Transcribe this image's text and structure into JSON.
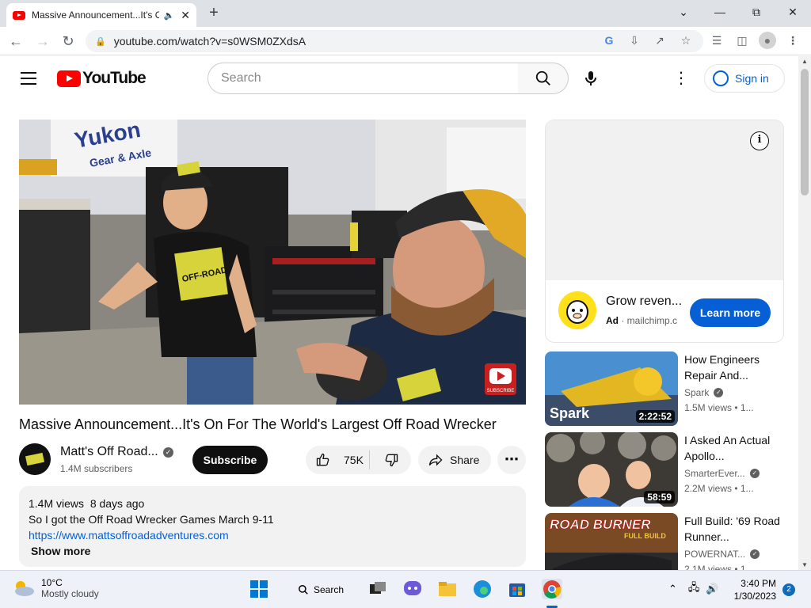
{
  "browser": {
    "tab_title": "Massive Announcement...It's On For The World's Largest Off Road Wrecker",
    "url": "youtube.com/watch?v=s0WSM0ZXdsA"
  },
  "youtube": {
    "logo_text": "YouTube",
    "search_placeholder": "Search",
    "signin_label": "Sign in"
  },
  "video": {
    "title": "Massive Announcement...It's On For The World's Largest Off Road Wrecker",
    "channel_name": "Matt's Off Road...",
    "subscribers": "1.4M subscribers",
    "subscribe_label": "Subscribe",
    "likes": "75K",
    "share_label": "Share",
    "banner_text_1": "Yukon",
    "banner_text_2": "Gear & Axle",
    "shirt_text": "OFF-ROAD",
    "watermark_text": "SUBSCRIBE",
    "description": {
      "views": "1.4M views",
      "age": "8 days ago",
      "line1": "So I got the Off Road Wrecker Games March 9-11",
      "link": "https://www.mattsoffroadadventures.com",
      "show_more": "Show more"
    }
  },
  "ad": {
    "title": "Grow reven...",
    "badge": "Ad",
    "domain": "mailchimp.c",
    "cta": "Learn more"
  },
  "related": [
    {
      "title": "How Engineers Repair And...",
      "channel": "Spark",
      "stats": "1.5M views • 1...",
      "duration": "2:22:52",
      "thumb_text": "Spark"
    },
    {
      "title": "I Asked An Actual Apollo...",
      "channel": "SmarterEver...",
      "stats": "2.2M views • 1...",
      "duration": "58:59",
      "thumb_text": ""
    },
    {
      "title": "Full Build: '69 Road Runner...",
      "channel": "POWERNAT...",
      "stats": "2.1M views • 1...",
      "duration": "",
      "thumb_text": "ROAD BURNER",
      "thumb_text_2": "FULL BUILD"
    }
  ],
  "taskbar": {
    "temp": "10°C",
    "condition": "Mostly cloudy",
    "search_label": "Search",
    "time": "3:40 PM",
    "date": "1/30/2023",
    "notif_count": "2"
  }
}
